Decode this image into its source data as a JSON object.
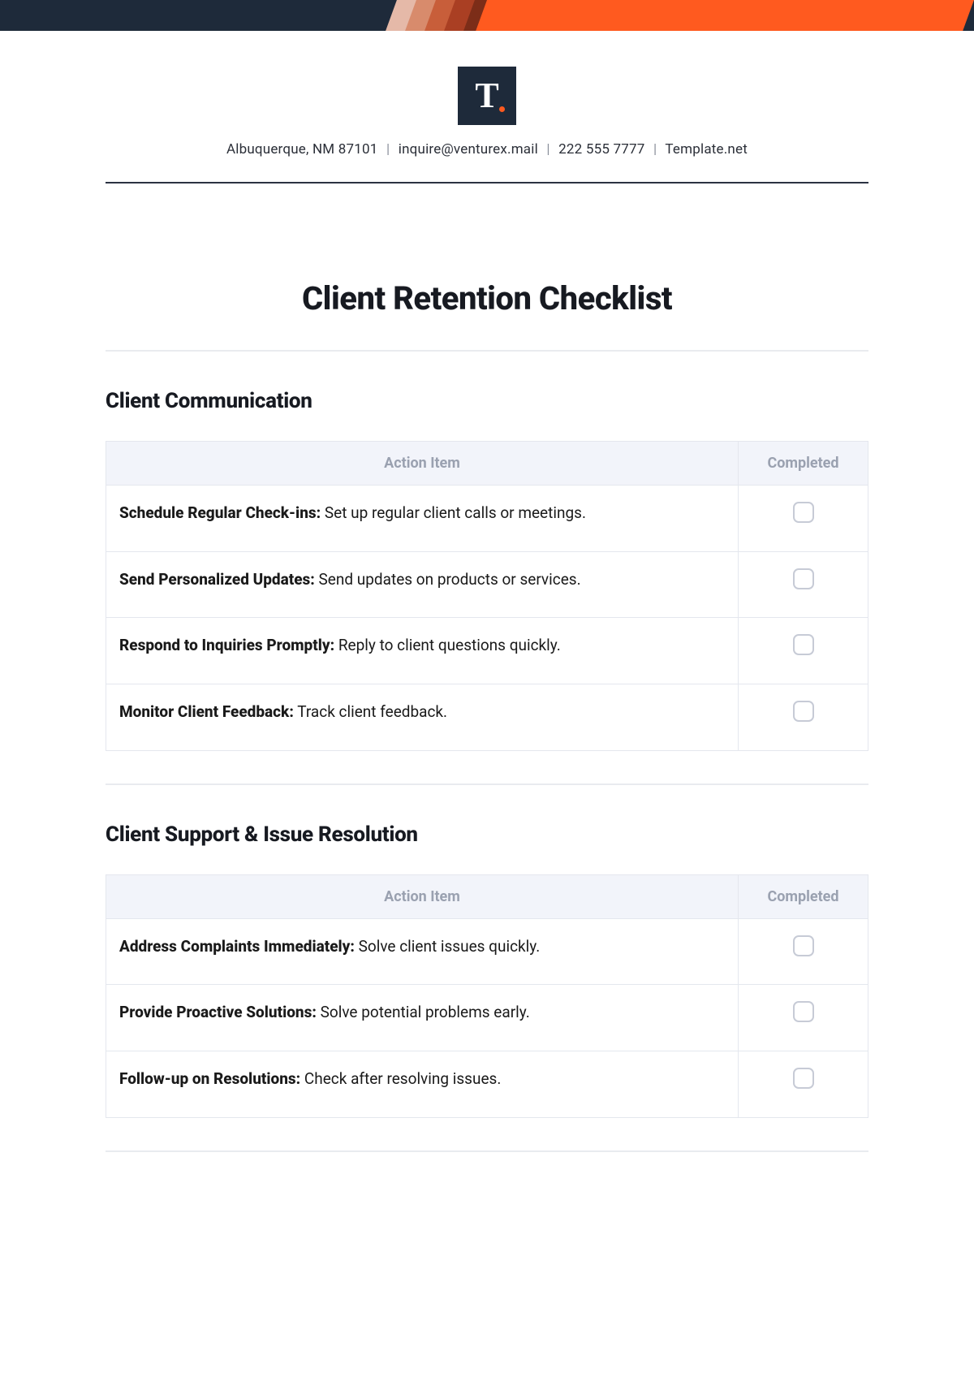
{
  "header": {
    "logo_letter": "T",
    "contact": {
      "address": "Albuquerque, NM 87101",
      "email": "inquire@venturex.mail",
      "phone": "222 555 7777",
      "site": "Template.net"
    }
  },
  "title": "Client Retention Checklist",
  "table_headers": {
    "action": "Action Item",
    "completed": "Completed"
  },
  "sections": [
    {
      "heading": "Client Communication",
      "items": [
        {
          "title": "Schedule Regular Check-ins:",
          "desc": " Set up regular client calls or meetings."
        },
        {
          "title": "Send Personalized Updates:",
          "desc": " Send updates on products or services."
        },
        {
          "title": "Respond to Inquiries Promptly:",
          "desc": " Reply to client questions quickly."
        },
        {
          "title": "Monitor Client Feedback:",
          "desc": " Track client feedback."
        }
      ]
    },
    {
      "heading": "Client Support & Issue Resolution",
      "items": [
        {
          "title": "Address Complaints Immediately:",
          "desc": " Solve client issues quickly."
        },
        {
          "title": "Provide Proactive Solutions:",
          "desc": " Solve potential problems early."
        },
        {
          "title": "Follow-up on Resolutions:",
          "desc": " Check after resolving issues."
        }
      ]
    }
  ]
}
